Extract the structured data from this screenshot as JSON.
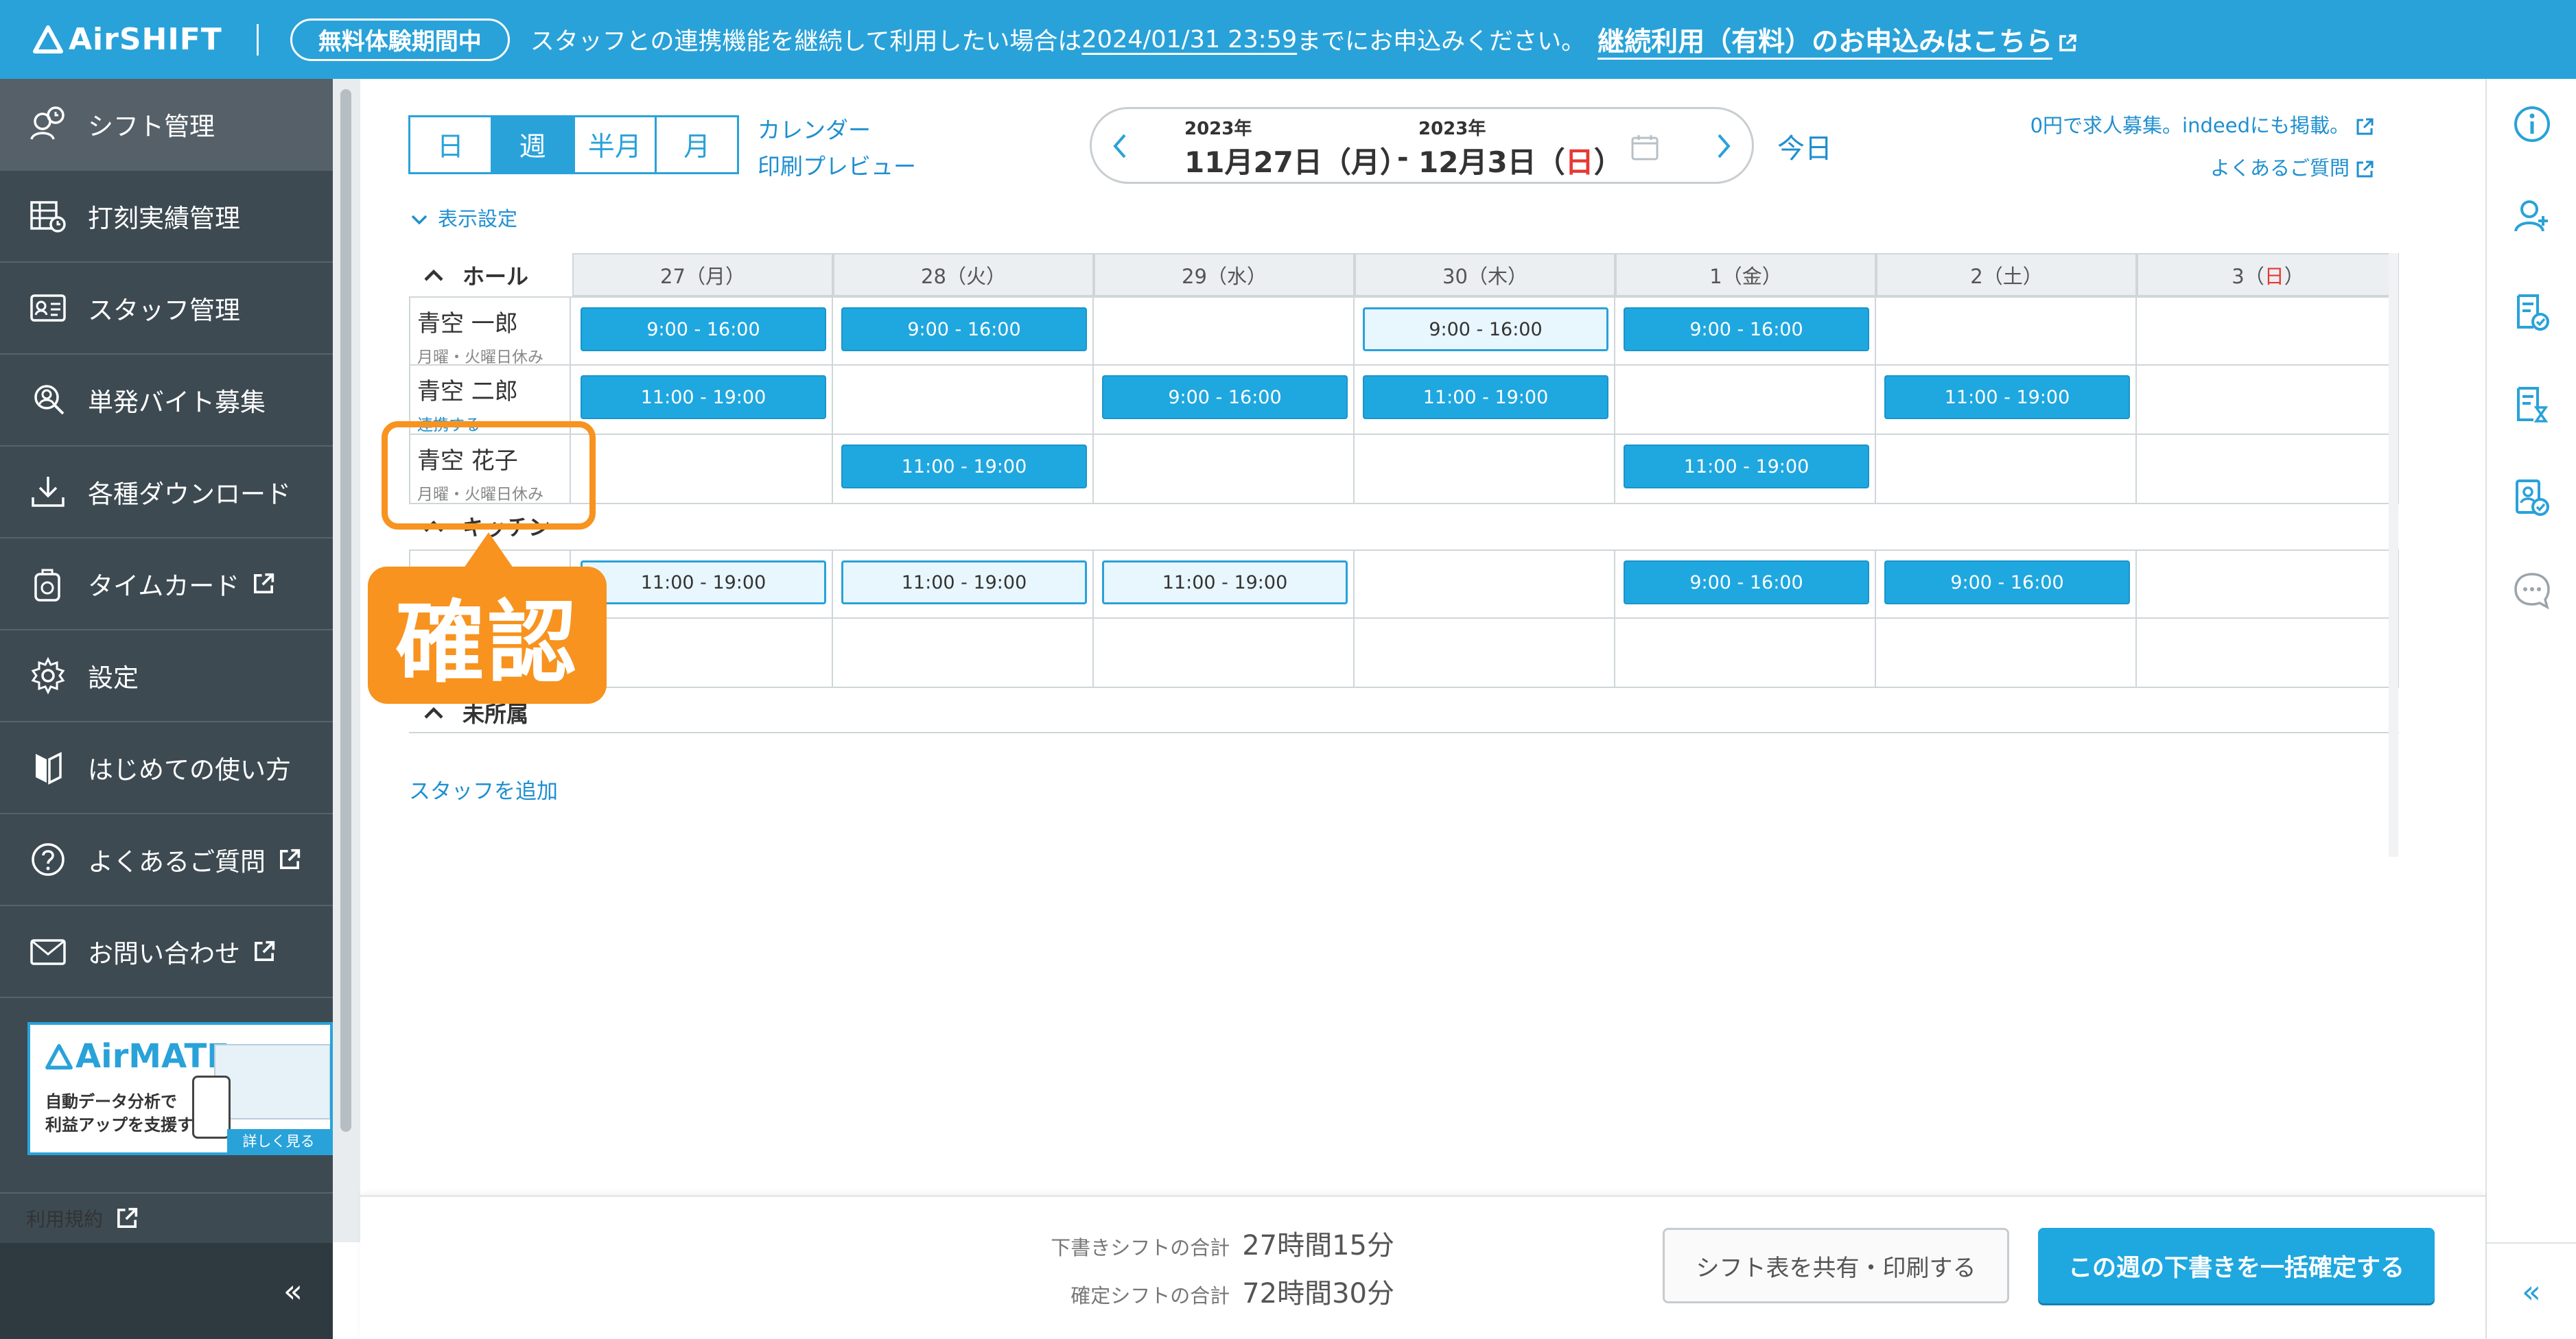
{
  "banner": {
    "logo": "AirSHIFT",
    "trial": "無料体験期間中",
    "text_before": "スタッフとの連携機能を継続して利用したい場合は",
    "deadline": "2024/01/31 23:59",
    "text_after": "までにお申込みください。",
    "link": "継続利用（有料）のお申込みはこちら"
  },
  "sidebar": {
    "items": [
      {
        "label": "シフト管理",
        "icon": "shift-icon"
      },
      {
        "label": "打刻実績管理",
        "icon": "timesheet-icon"
      },
      {
        "label": "スタッフ管理",
        "icon": "staff-card-icon"
      },
      {
        "label": "単発バイト募集",
        "icon": "recruit-icon"
      },
      {
        "label": "各種ダウンロード",
        "icon": "download-icon"
      },
      {
        "label": "タイムカード",
        "icon": "timecard-icon"
      },
      {
        "label": "設定",
        "icon": "gear-icon"
      },
      {
        "label": "はじめての使い方",
        "icon": "guide-icon"
      },
      {
        "label": "よくあるご質問",
        "icon": "question-icon"
      },
      {
        "label": "お問い合わせ",
        "icon": "mail-icon"
      }
    ],
    "ad": {
      "logo": "AirMATE",
      "line1": "自動データ分析で",
      "line2": "利益アップを支援する",
      "more": "詳しく見る"
    },
    "terms": "利用規約",
    "collapse": "«"
  },
  "toolbar": {
    "tabs": [
      "日",
      "週",
      "半月",
      "月"
    ],
    "active_tab": "週",
    "calendar_link": "カレンダー",
    "print_link": "印刷プレビュー",
    "start_year": "2023年",
    "start_date": "11月27日（月）",
    "end_year": "2023年",
    "end_date_pre": "12月3日（",
    "end_date_day": "日",
    "end_date_post": "）",
    "dash": "-",
    "today": "今日",
    "indeed_link": "0円で求人募集。indeedにも掲載。",
    "faq_link": "よくあるご質問",
    "display_settings": "表示設定"
  },
  "grid": {
    "days": [
      "27（月）",
      "28（火）",
      "29（水）",
      "30（木）",
      "1（金）",
      "2（土）"
    ],
    "sunday_pre": "3（",
    "sunday_day": "日",
    "sunday_post": "）",
    "sections": [
      {
        "label": "ホール"
      },
      {
        "label": "キッチン"
      },
      {
        "label": "未所属"
      }
    ],
    "staff": [
      {
        "name": "青空 一郎",
        "note": "月曜・火曜日休み"
      },
      {
        "name": "青空 二郎",
        "note": "連携する"
      },
      {
        "name": "青空 花子",
        "note": "月曜・火曜日休み"
      }
    ],
    "shift_a": "9:00 - 16:00",
    "shift_b": "11:00 - 19:00",
    "add_staff": "スタッフを追加"
  },
  "callout": {
    "label": "確認",
    "color": "#f7931e"
  },
  "footer": {
    "draft_label": "下書きシフトの合計",
    "draft_value": "27時間15分",
    "confirmed_label": "確定シフトの合計",
    "confirmed_value": "72時間30分",
    "share_button": "シフト表を共有・印刷する",
    "confirm_button": "この週の下書きを一括確定する"
  },
  "colors": {
    "brand": "#29a2d9",
    "sidebar": "#3d4a52",
    "sunday": "#e53935"
  }
}
